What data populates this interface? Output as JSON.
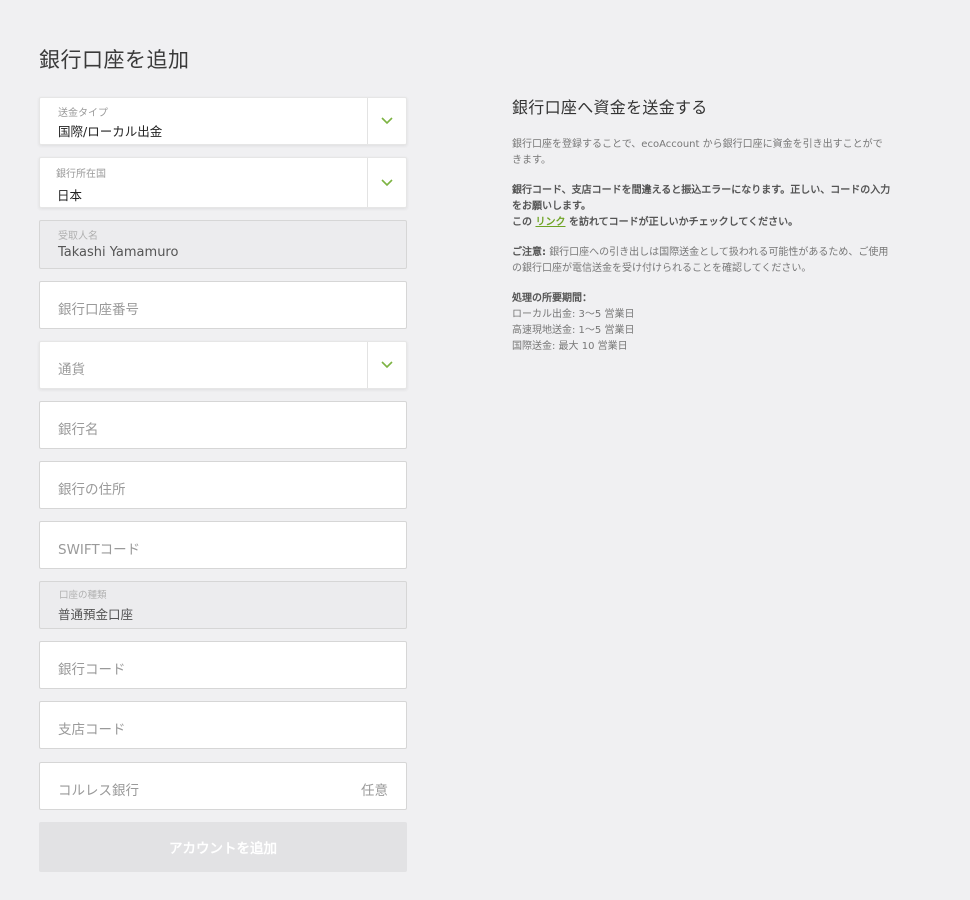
{
  "page": {
    "title": "銀行口座を追加"
  },
  "form": {
    "transfer_type": {
      "label": "送金タイプ",
      "value": "国際/ローカル出金"
    },
    "bank_country": {
      "label": "銀行所在国",
      "value": "日本"
    },
    "recipient_name": {
      "label": "受取人名",
      "value": "Takashi Yamamuro"
    },
    "account_number": {
      "placeholder": "銀行口座番号"
    },
    "currency": {
      "placeholder": "通貨"
    },
    "bank_name": {
      "placeholder": "銀行名"
    },
    "bank_address": {
      "placeholder": "銀行の住所"
    },
    "swift_code": {
      "placeholder": "SWIFTコード"
    },
    "account_type": {
      "label": "口座の種類",
      "value": "普通預金口座"
    },
    "bank_code": {
      "placeholder": "銀行コード"
    },
    "branch_code": {
      "placeholder": "支店コード"
    },
    "correspondent_bank": {
      "placeholder": "コルレス銀行",
      "optional": "任意"
    },
    "submit_label": "アカウントを追加"
  },
  "info": {
    "title": "銀行口座へ資金を送金する",
    "intro": "銀行口座を登録することで、ecoAccount から銀行口座に資金を引き出すことができます。",
    "warning": "銀行コード、支店コードを間違えると振込エラーになります。正しい、コードの入力をお願いします。",
    "link_prefix": "この",
    "link_text": "リンク",
    "link_suffix": "を訪れてコードが正しいかチェックしてください。",
    "caution_label": "ご注意:",
    "caution_text": "銀行口座への引き出しは国際送金として扱われる可能性があるため、ご使用の銀行口座が電信送金を受け付けられることを確認してください。",
    "processing_title": "処理の所要期間：",
    "processing_items": [
      "ローカル出金: 3〜5 営業日",
      "高速現地送金: 1〜5 営業日",
      "国際送金: 最大 10 営業日"
    ]
  },
  "colors": {
    "accent": "#6ea324",
    "background": "#f0f0f2"
  },
  "icons": {
    "chevron": "chevron-down-icon"
  }
}
